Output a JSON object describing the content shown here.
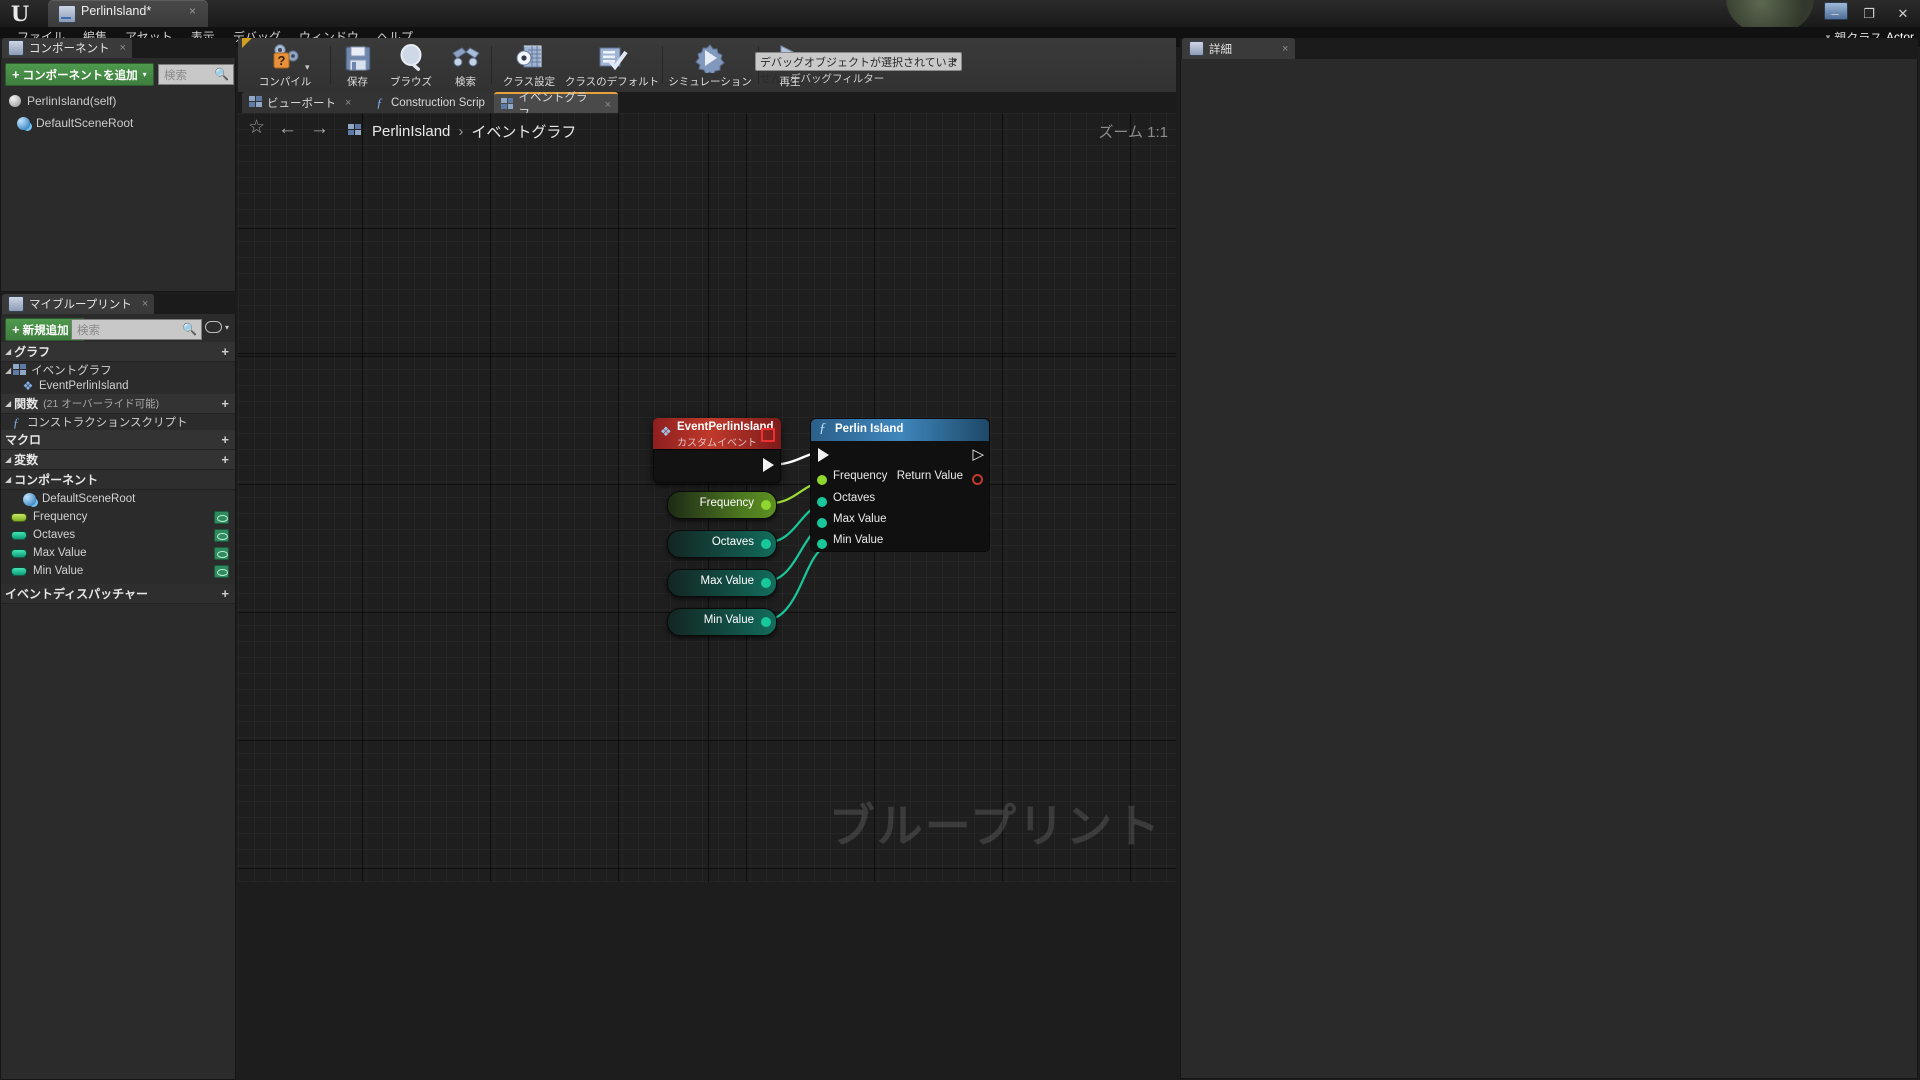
{
  "window": {
    "app_icon": "unreal-logo-icon",
    "document_tab": {
      "title": "PerlinIsland*",
      "close": "×",
      "icon": "blueprint-icon"
    },
    "buttons": {
      "minimize": "–",
      "maximize": "❐",
      "close": "✕"
    }
  },
  "menu": {
    "items": [
      {
        "label": "ファイル"
      },
      {
        "label": "編集"
      },
      {
        "label": "アセット"
      },
      {
        "label": "表示"
      },
      {
        "label": "デバッグ"
      },
      {
        "label": "ウィンドウ"
      },
      {
        "label": "ヘルプ"
      }
    ]
  },
  "class_bar": {
    "prefix": "親クラス",
    "link": "Actor"
  },
  "toolbar": {
    "buttons": [
      {
        "label": "コンパイル",
        "icon": "compile-icon",
        "has_dropdown": true
      },
      {
        "label": "保存",
        "icon": "save-icon",
        "has_dropdown": false
      },
      {
        "label": "ブラウズ",
        "icon": "browse-icon",
        "has_dropdown": false
      },
      {
        "label": "検索",
        "icon": "find-icon",
        "has_dropdown": false
      },
      {
        "label": "クラス設定",
        "icon": "class-settings-icon",
        "has_dropdown": false
      },
      {
        "label": "クラスのデフォルト",
        "icon": "class-defaults-icon",
        "has_dropdown": false
      },
      {
        "label": "シミュレーション",
        "icon": "simulate-icon",
        "has_dropdown": false
      },
      {
        "label": "再生",
        "icon": "play-icon",
        "has_dropdown": true
      }
    ],
    "debug_select": {
      "value": "デバッグオブジェクトが選択されていません",
      "caret": "▾"
    },
    "debug_filter_label": "デバッグフィルター"
  },
  "components_panel": {
    "tab": {
      "label": "コンポーネント",
      "close": "×",
      "icon": "components-icon"
    },
    "add_button": {
      "label": "コンポーネントを追加",
      "plus": "+",
      "caret": "▾"
    },
    "search_placeholder": "検索",
    "tree": [
      {
        "label": "PerlinIsland(self)",
        "icon": "actor-root-icon",
        "indent": 0
      },
      {
        "label": "DefaultSceneRoot",
        "icon": "scene-root-icon",
        "indent": 1
      }
    ]
  },
  "my_blueprint_panel": {
    "tab": {
      "label": "マイブループリント",
      "close": "×",
      "icon": "blueprint-icon"
    },
    "add_button": {
      "label": "新規追加",
      "plus": "+",
      "caret": "▾"
    },
    "search_placeholder": "検索",
    "eye_caret": "▾",
    "sections": [
      {
        "title": "グラフ",
        "sub": "",
        "arrow": "◢",
        "plus": "+",
        "items": [
          {
            "label": "イベントグラフ",
            "icon": "event-graph-icon",
            "indent": 0,
            "arrow": "◢"
          },
          {
            "label": "EventPerlinIsland",
            "icon": "event-node-icon",
            "indent": 1,
            "arrow": ""
          }
        ]
      },
      {
        "title": "関数",
        "sub": "(21 オーバーライド可能)",
        "arrow": "◢",
        "plus": "+",
        "items": [
          {
            "label": "コンストラクションスクリプト",
            "icon": "function-icon",
            "indent": 0,
            "arrow": ""
          }
        ]
      },
      {
        "title": "マクロ",
        "sub": "",
        "arrow": "",
        "plus": "+",
        "items": []
      },
      {
        "title": "変数",
        "sub": "",
        "arrow": "◢",
        "plus": "+",
        "items": []
      },
      {
        "title": "コンポーネント",
        "sub": "",
        "arrow": "◢",
        "plus": "",
        "items": []
      }
    ],
    "components": [
      {
        "label": "DefaultSceneRoot",
        "icon": "scene-root-icon"
      }
    ],
    "variables": [
      {
        "label": "Frequency",
        "color": "#a4d64a",
        "editable_icon": "eye-icon"
      },
      {
        "label": "Octaves",
        "color": "#19c89a",
        "editable_icon": "eye-icon"
      },
      {
        "label": "Max Value",
        "color": "#19c89a",
        "editable_icon": "eye-icon"
      },
      {
        "label": "Min Value",
        "color": "#19c89a",
        "editable_icon": "eye-icon"
      }
    ],
    "event_dispatchers": {
      "title": "イベントディスパッチャー",
      "plus": "+"
    }
  },
  "graph_tabs": [
    {
      "label": "ビューポート",
      "close": "×",
      "icon": "viewport-icon",
      "active": false
    },
    {
      "label": "Construction Scrip",
      "close": "×",
      "icon": "function-icon",
      "active": false
    },
    {
      "label": "イベントグラフ",
      "close": "×",
      "icon": "event-graph-icon",
      "active": true
    }
  ],
  "graph_bar": {
    "star": "☆",
    "back": "←",
    "forward": "→",
    "breadcrumb": [
      "PerlinIsland",
      "イベントグラフ"
    ],
    "separator": "›",
    "zoom": "ズーム 1:1",
    "watermark": "ブループリント"
  },
  "graph": {
    "event_node": {
      "title": "EventPerlinIsland",
      "subtitle": "カスタムイベント",
      "icon": "event-node-icon",
      "header_color": "#c0392b"
    },
    "variable_nodes": [
      {
        "label": "Frequency",
        "pin_color": "#8fd62e"
      },
      {
        "label": "Octaves",
        "pin_color": "#19c89a"
      },
      {
        "label": "Max Value",
        "pin_color": "#19c89a"
      },
      {
        "label": "Min Value",
        "pin_color": "#19c89a"
      }
    ],
    "function_node": {
      "title": "Perlin Island",
      "icon": "function-icon",
      "header_color": "#3f87bd",
      "inputs": [
        {
          "label": "Frequency",
          "pin_color": "#8fd62e"
        },
        {
          "label": "Octaves",
          "pin_color": "#19c89a"
        },
        {
          "label": "Max Value",
          "pin_color": "#19c89a"
        },
        {
          "label": "Min Value",
          "pin_color": "#19c89a"
        }
      ],
      "outputs": [
        {
          "label": "Return Value",
          "pin_color": "#c0392b"
        }
      ]
    }
  },
  "details_panel": {
    "tab": {
      "label": "詳細",
      "close": "×",
      "icon": "details-icon"
    }
  }
}
